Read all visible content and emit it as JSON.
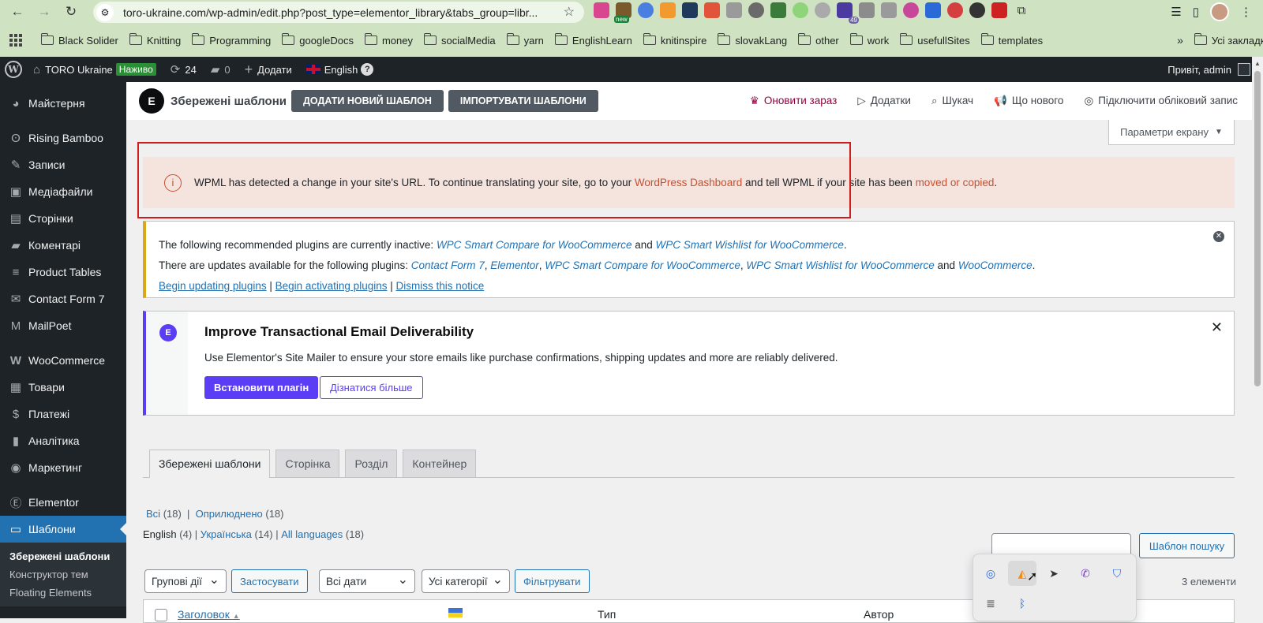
{
  "browser": {
    "url": "toro-ukraine.com/wp-admin/edit.php?post_type=elementor_library&tabs_group=libr...",
    "ext_new_badge": "new",
    "ext_count_badge": "49",
    "bookmarks": [
      "Black Solider",
      "Knitting",
      "Programming",
      "googleDocs",
      "money",
      "socialMedia",
      "yarn",
      "EnglishLearn",
      "knitinspire",
      "slovakLang",
      "other",
      "work",
      "usefullSites",
      "templates"
    ],
    "all_bookmarks": "Усі закладки"
  },
  "adminbar": {
    "site_name": "TORO Ukraine",
    "live_badge": "Наживо",
    "updates_count": "24",
    "comments_count": "0",
    "add_label": "Додати",
    "language": "English",
    "help": "?",
    "howdy": "Привіт, admin"
  },
  "sidebar": {
    "items": [
      {
        "label": "Майстерня",
        "icon": "dashboard-icon"
      },
      {
        "label": "Rising Bamboo",
        "icon": "bamboo-icon"
      },
      {
        "label": "Записи",
        "icon": "pin-icon"
      },
      {
        "label": "Медіафайли",
        "icon": "media-icon"
      },
      {
        "label": "Сторінки",
        "icon": "pages-icon"
      },
      {
        "label": "Коментарі",
        "icon": "comment-icon"
      },
      {
        "label": "Product Tables",
        "icon": "list-icon"
      },
      {
        "label": "Contact Form 7",
        "icon": "mail-icon"
      },
      {
        "label": "MailPoet",
        "icon": "mailpoet-icon"
      },
      {
        "label": "WooCommerce",
        "icon": "woo-icon"
      },
      {
        "label": "Товари",
        "icon": "archive-icon"
      },
      {
        "label": "Платежі",
        "icon": "payment-icon"
      },
      {
        "label": "Аналітика",
        "icon": "chart-icon"
      },
      {
        "label": "Маркетинг",
        "icon": "megaphone-icon"
      },
      {
        "label": "Elementor",
        "icon": "elementor-icon"
      },
      {
        "label": "Шаблони",
        "icon": "folder-icon"
      }
    ],
    "submenu": [
      "Збережені шаблони",
      "Конструктор тем",
      "Floating Elements"
    ]
  },
  "elementor_bar": {
    "title": "Збережені шаблони",
    "add_new": "ДОДАТИ НОВИЙ ШАБЛОН",
    "import": "ІМПОРТУВАТИ ШАБЛОНИ",
    "upgrade": "Оновити зараз",
    "addons": "Додатки",
    "finder": "Шукач",
    "whats_new": "Що нового",
    "connect": "Підключити обліковий запис"
  },
  "screen_options": "Параметри екрану",
  "wpml_notice": {
    "before": "WPML has detected a change in your site's URL. To continue translating your site, go to your ",
    "link1": "WordPress Dashboard",
    "middle": " and tell WPML if your site has been ",
    "link2": "moved or copied",
    "after": "."
  },
  "plugins_notice": {
    "line1_text": "The following recommended plugins are currently inactive: ",
    "line1_link1": "WPC Smart Compare for WooCommerce",
    "line1_and": " and ",
    "line1_link2": "WPC Smart Wishlist for WooCommerce",
    "line2_text": "There are updates available for the following plugins: ",
    "line2_link1": "Contact Form 7",
    "line2_link2": "Elementor",
    "line2_link3": "WPC Smart Compare for WooCommerce",
    "line2_link4": "WPC Smart Wishlist for WooCommerce",
    "line2_link5": "WooCommerce",
    "action1": "Begin updating plugins",
    "action2": "Begin activating plugins",
    "action3": "Dismiss this notice"
  },
  "elementor_notice": {
    "title": "Improve Transactional Email Deliverability",
    "text": "Use Elementor's Site Mailer to ensure your store emails like purchase confirmations, shipping updates and more are reliably delivered.",
    "install": "Встановити плагін",
    "learn_more": "Дізнатися більше"
  },
  "tabs": [
    "Збережені шаблони",
    "Сторінка",
    "Розділ",
    "Контейнер"
  ],
  "filters": {
    "all": "Всі",
    "all_count": "(18)",
    "published": "Оприлюднено",
    "published_count": "(18)",
    "lang_en": "English",
    "lang_en_count": "(4)",
    "lang_uk": "Українська",
    "lang_uk_count": "(14)",
    "lang_all": "All languages",
    "lang_all_count": "(18)"
  },
  "search_button": "Шаблон пошуку",
  "bulk_actions": "Групові дії",
  "apply": "Застосувати",
  "all_dates": "Всі дати",
  "all_categories": "Усі категорії",
  "filter": "Фільтрувати",
  "items_count": "3 елементи",
  "table": {
    "col_title": "Заголовок",
    "col_type": "Тип",
    "col_author": "Автор"
  }
}
